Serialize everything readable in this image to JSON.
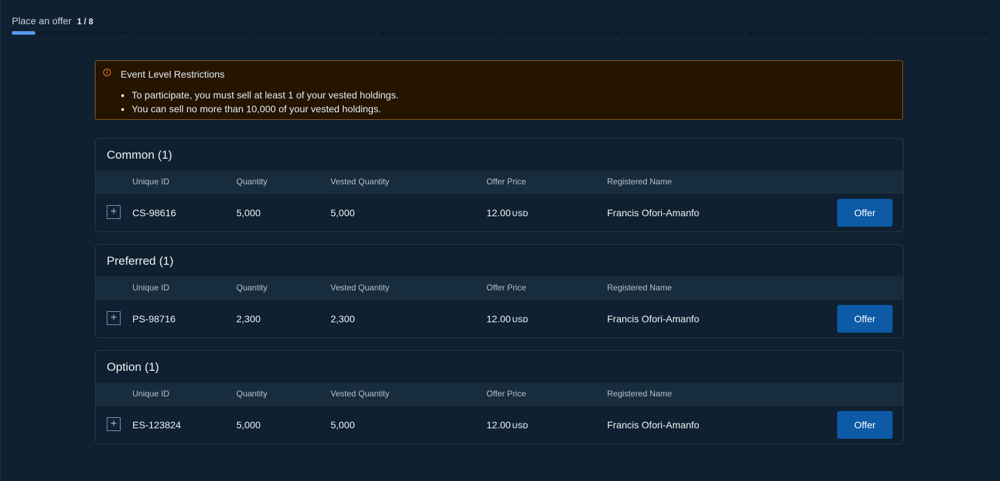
{
  "header": {
    "title": "Place an offer",
    "step": "1 / 8",
    "total_steps": 8,
    "current_step": 1,
    "current_step_progress": 0.2
  },
  "alert": {
    "title": "Event Level Restrictions",
    "items": [
      "To participate, you must sell at least 1 of your vested holdings.",
      "You can sell no more than 10,000 of your vested holdings."
    ]
  },
  "columns": {
    "unique_id": "Unique ID",
    "quantity": "Quantity",
    "vested_quantity": "Vested Quantity",
    "offer_price": "Offer Price",
    "registered_name": "Registered Name"
  },
  "sections": [
    {
      "title": "Common (1)",
      "row": {
        "unique_id": "CS-98616",
        "quantity": "5,000",
        "vested_quantity": "5,000",
        "offer_price": "12.00",
        "currency": "USD",
        "registered_name": "Francis Ofori-Amanfo",
        "action_label": "Offer",
        "expand_symbol": "+"
      }
    },
    {
      "title": "Preferred (1)",
      "row": {
        "unique_id": "PS-98716",
        "quantity": "2,300",
        "vested_quantity": "2,300",
        "offer_price": "12.00",
        "currency": "USD",
        "registered_name": "Francis Ofori-Amanfo",
        "action_label": "Offer",
        "expand_symbol": "+"
      }
    },
    {
      "title": "Option (1)",
      "row": {
        "unique_id": "ES-123824",
        "quantity": "5,000",
        "vested_quantity": "5,000",
        "offer_price": "12.00",
        "currency": "USD",
        "registered_name": "Francis Ofori-Amanfo",
        "action_label": "Offer",
        "expand_symbol": "+"
      }
    }
  ],
  "colors": {
    "background": "#0f2130",
    "accent": "#5b9bf0",
    "button": "#0d5aa7",
    "warning": "#ff7a2f",
    "warning_bg": "#241400"
  }
}
